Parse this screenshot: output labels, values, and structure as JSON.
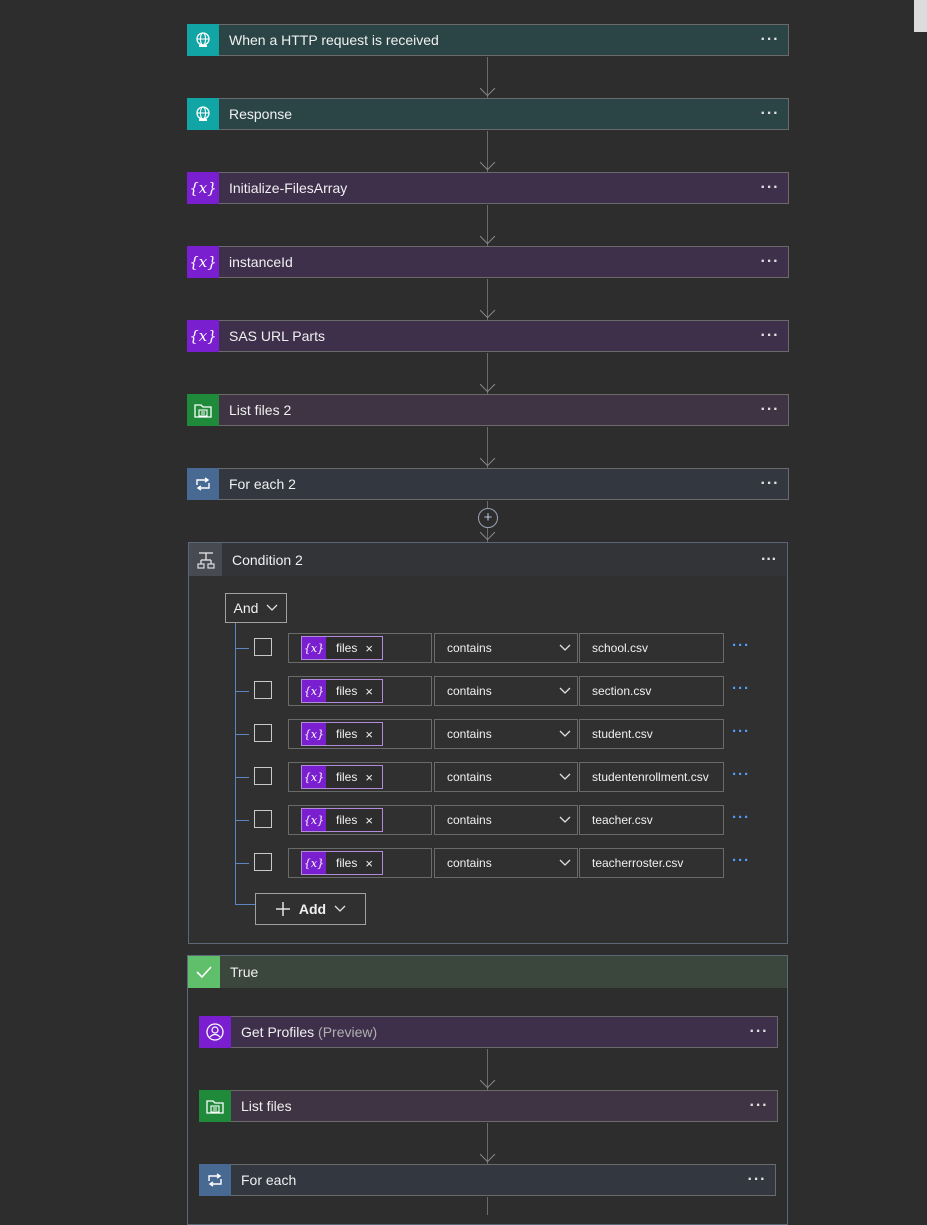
{
  "steps": [
    {
      "title": "When a HTTP request is received",
      "icon": "globe-icon"
    },
    {
      "title": "Response",
      "icon": "globe-icon"
    },
    {
      "title": "Initialize-FilesArray",
      "icon": "variable-icon"
    },
    {
      "title": "instanceId",
      "icon": "variable-icon"
    },
    {
      "title": "SAS URL Parts",
      "icon": "variable-icon"
    },
    {
      "title": "List files 2",
      "icon": "file-share-icon"
    },
    {
      "title": "For each 2",
      "icon": "loop-icon"
    }
  ],
  "more_glyph": "···",
  "condition": {
    "title": "Condition 2",
    "group_operator": "And",
    "add_label": "Add",
    "rows": [
      {
        "token": "files",
        "operator": "contains",
        "value": "school.csv"
      },
      {
        "token": "files",
        "operator": "contains",
        "value": "section.csv"
      },
      {
        "token": "files",
        "operator": "contains",
        "value": "student.csv"
      },
      {
        "token": "files",
        "operator": "contains",
        "value": "studentenrollment.csv"
      },
      {
        "token": "files",
        "operator": "contains",
        "value": "teacher.csv"
      },
      {
        "token": "files",
        "operator": "contains",
        "value": "teacherroster.csv"
      }
    ]
  },
  "true_branch": {
    "title": "True",
    "steps": [
      {
        "title": "Get Profiles",
        "suffix": "(Preview)",
        "icon": "profile-icon"
      },
      {
        "title": "List files",
        "icon": "file-share-icon"
      },
      {
        "title": "For each",
        "icon": "loop-icon"
      }
    ]
  },
  "colors": {
    "http": "#12a5a5",
    "variable": "#7a1fcf",
    "file_share": "#1e8a3a",
    "loop": "#486991",
    "true_check": "#5fbf6a"
  }
}
